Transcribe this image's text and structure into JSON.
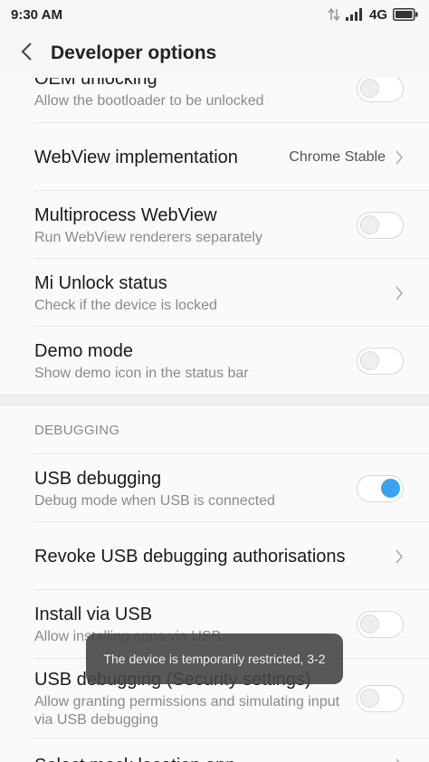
{
  "status_bar": {
    "time": "9:30 AM",
    "network": "4G"
  },
  "toolbar": {
    "title": "Developer options"
  },
  "rows": [
    {
      "title": "OEM unlocking",
      "subtitle": "Allow the bootloader to be unlocked",
      "control": "toggle",
      "on": false
    },
    {
      "title": "WebView implementation",
      "value": "Chrome Stable",
      "control": "chevron"
    },
    {
      "title": "Multiprocess WebView",
      "subtitle": "Run WebView renderers separately",
      "control": "toggle",
      "on": false
    },
    {
      "title": "Mi Unlock status",
      "subtitle": "Check if the device is locked",
      "control": "chevron"
    },
    {
      "title": "Demo mode",
      "subtitle": "Show demo icon in the status bar",
      "control": "toggle",
      "on": false
    }
  ],
  "section": {
    "header": "DEBUGGING"
  },
  "debug_rows": [
    {
      "title": "USB debugging",
      "subtitle": "Debug mode when USB is connected",
      "control": "toggle",
      "on": true
    },
    {
      "title": "Revoke USB debugging authorisations",
      "control": "chevron"
    },
    {
      "title": "Install via USB",
      "subtitle": "Allow installing apps via USB",
      "control": "toggle",
      "on": false
    },
    {
      "title": "USB debugging (Security settings)",
      "subtitle": "Allow granting permissions and simulating input via USB debugging",
      "control": "toggle",
      "on": false
    },
    {
      "title": "Select mock location app",
      "control": "chevron"
    }
  ],
  "toast": {
    "text": "The device is temporarily restricted, 3-2"
  },
  "colors": {
    "accent": "#3aa1f3",
    "toast_bg": "#464646"
  }
}
